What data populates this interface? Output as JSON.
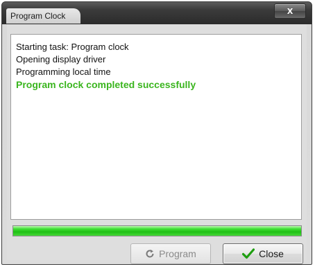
{
  "window": {
    "title": "Program Clock",
    "close_glyph": "x"
  },
  "log": {
    "lines": [
      "Starting task: Program clock",
      "Opening display driver",
      "Programming local time"
    ],
    "success_line": "Program clock completed successfully"
  },
  "progress": {
    "fraction": 1.0
  },
  "buttons": {
    "program_label": "Program",
    "program_icon": "refresh-icon",
    "close_label": "Close",
    "close_icon": "checkmark-icon"
  },
  "colors": {
    "success_text": "#3ab51e",
    "progress_fill": "#2fcf22",
    "check_icon": "#1e9e10"
  }
}
